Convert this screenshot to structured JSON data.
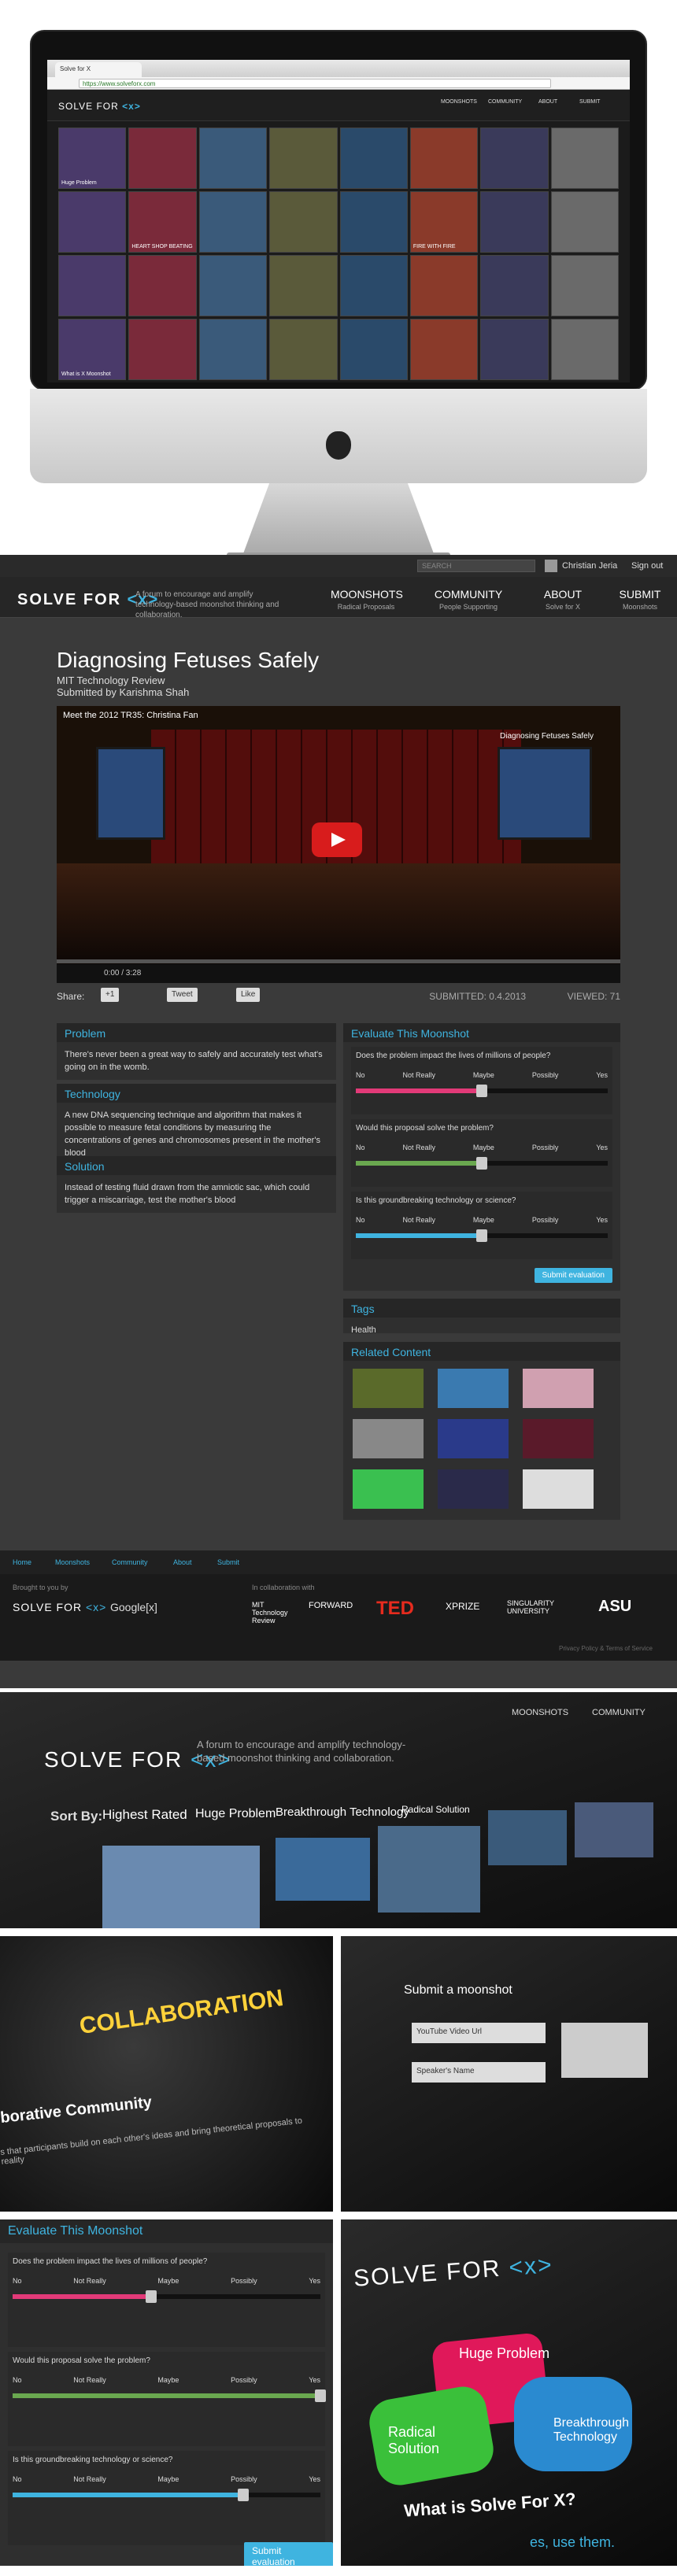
{
  "imac": {
    "tab": "Solve for X",
    "url": "https://www.solveforx.com",
    "logo": "SOLVE FOR",
    "logo_x": "<x>",
    "nav": [
      {
        "label": "MOONSHOTS",
        "sub": "Radical Proposals"
      },
      {
        "label": "COMMUNITY",
        "sub": "People Supporting"
      },
      {
        "label": "ABOUT",
        "sub": "Solve for X"
      },
      {
        "label": "SUBMIT",
        "sub": "Moonshots"
      }
    ],
    "tiles": [
      "Huge Problem",
      "",
      "",
      "",
      "",
      "",
      "",
      "",
      "",
      "HEART SHOP BEATING",
      "",
      "",
      "",
      "FIRE WITH FIRE",
      "",
      "",
      "",
      "",
      "",
      "",
      "",
      "",
      "",
      "",
      "What is X Moonshot",
      "",
      "",
      "",
      "",
      "",
      "",
      ""
    ]
  },
  "site": {
    "search_placeholder": "SEARCH",
    "user": "Christian Jeria",
    "signout": "Sign out",
    "logo": "SOLVE FOR",
    "logo_x": "<x>",
    "tagline": "A forum to encourage and amplify technology-based moonshot thinking and collaboration.",
    "nav": [
      {
        "label": "MOONSHOTS",
        "sub": "Radical Proposals"
      },
      {
        "label": "COMMUNITY",
        "sub": "People Supporting"
      },
      {
        "label": "ABOUT",
        "sub": "Solve for X"
      },
      {
        "label": "SUBMIT",
        "sub": "Moonshots"
      }
    ],
    "title": "Diagnosing Fetuses Safely",
    "org": "MIT Technology Review",
    "submitted_by": "Submitted by Karishma Shah",
    "video_title": "Meet the 2012 TR35: Christina Fan",
    "screen_title": "Diagnosing Fetuses Safely",
    "time": "0:00 / 3:28",
    "share": "Share:",
    "share_btns": [
      "+1",
      "Tweet",
      "Like"
    ],
    "submitted": "SUBMITTED: 0.4.2013",
    "viewed": "VIEWED: 71",
    "problem": {
      "head": "Problem",
      "body": "There's never been a great way to safely and accurately test what's going on in the womb."
    },
    "technology": {
      "head": "Technology",
      "body": "A new DNA sequencing technique and algorithm that makes it possible to measure fetal conditions by measuring the concentrations of genes and chromosomes present in the mother's blood"
    },
    "solution": {
      "head": "Solution",
      "body": "Instead of testing fluid drawn from the amniotic sac, which could trigger a miscarriage, test the mother's blood"
    },
    "evaluate": {
      "head": "Evaluate This Moonshot",
      "scale": [
        "No",
        "Not Really",
        "Maybe",
        "Possibly",
        "Yes"
      ],
      "questions": [
        {
          "q": "Does the problem impact the lives of millions of people?",
          "color": "#e23a78",
          "value": 0.5
        },
        {
          "q": "Would this proposal solve the problem?",
          "color": "#6aa84f",
          "value": 0.5
        },
        {
          "q": "Is this groundbreaking technology or science?",
          "color": "#3fb4e0",
          "value": 0.5
        }
      ],
      "button": "Submit evaluation"
    },
    "tags": {
      "head": "Tags",
      "items": [
        "Health"
      ]
    },
    "related": {
      "head": "Related Content"
    },
    "footer_links": [
      "Home",
      "Moonshots",
      "Community",
      "About",
      "Submit"
    ],
    "brought_by": "Brought to you by",
    "in_collab": "In collaboration with",
    "partners": [
      "MIT Technology Review",
      "FORWARD",
      "TED",
      "XPRIZE",
      "SINGULARITY UNIVERSITY",
      "ASU"
    ],
    "google": "Google[x]",
    "legal": "Privacy Policy & Terms of Service"
  },
  "photo1": {
    "tagline": "A forum to encourage and amplify technology-based moonshot thinking and collaboration.",
    "sortby": "Sort By:",
    "sorts": [
      "Highest Rated",
      "Huge Problem",
      "Breakthrough Technology",
      "Radical Solution"
    ],
    "nav": [
      "MOONSHOTS",
      "COMMUNITY"
    ]
  },
  "photo2": {
    "title": "COLLABORATION",
    "heading": "borative Community",
    "text": "s that participants build on each other's ideas and bring theoretical proposals to reality"
  },
  "photo3": {
    "title": "Submit a moonshot",
    "field1": "YouTube Video Url",
    "field2": "Speaker's Name"
  },
  "photo4": {
    "head": "Evaluate This Moonshot",
    "scale": [
      "No",
      "Not Really",
      "Maybe",
      "Possibly",
      "Yes"
    ],
    "questions": [
      {
        "q": "Does the problem impact the lives of millions of people?",
        "color": "#e23a78",
        "value": 0.45
      },
      {
        "q": "Would this proposal solve the problem?",
        "color": "#6aa84f",
        "value": 1.0
      },
      {
        "q": "Is this groundbreaking technology or science?",
        "color": "#3fb4e0",
        "value": 0.75
      }
    ],
    "button": "Submit evaluation"
  },
  "photo5": {
    "labels": [
      "Huge Problem",
      "Radical Solution",
      "Breakthrough Technology",
      "What is Solve For X?"
    ],
    "bottom": "es, use them."
  }
}
